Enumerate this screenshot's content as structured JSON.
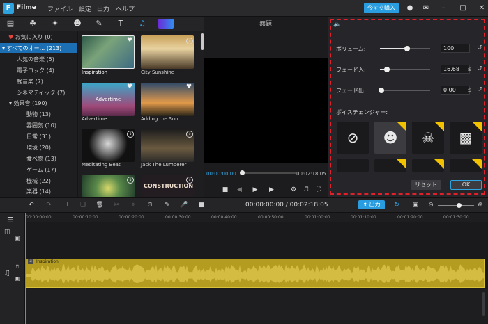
{
  "titlebar": {
    "app_name": "Filme",
    "menus": [
      "ファイル",
      "設定",
      "出力",
      "ヘルプ"
    ],
    "buy_label": "今すぐ購入",
    "window_controls": [
      "minimize-icon",
      "restore-icon",
      "close-icon"
    ]
  },
  "toolbar": {
    "icons": [
      "calendar-icon",
      "layers-icon",
      "sparkle-icon",
      "emoji-icon",
      "edit-icon",
      "text-icon",
      "music-icon",
      "effects-tip-icon"
    ],
    "active": "music-icon",
    "accent_color": "#2fa3e0"
  },
  "tree": {
    "favorites": "お気に入り (0)",
    "all_music": "すべてのオー... (213)",
    "items": [
      "人気の音楽 (5)",
      "電子ロック (4)",
      "軽音楽 (7)",
      "シネマティック (7)"
    ],
    "sfx": "効果音 (190)",
    "sfx_items": [
      "動物 (13)",
      "雰囲気 (10)",
      "日常 (31)",
      "環境 (20)",
      "食べ物 (13)",
      "ゲーム (17)",
      "機械 (22)",
      "楽器 (14)"
    ]
  },
  "media": [
    {
      "name": "Inspiration",
      "badge": "heart"
    },
    {
      "name": "City Sunshine",
      "badge": "download"
    },
    {
      "name": "Advertime",
      "badge": "heart"
    },
    {
      "name": "Adding the Sun",
      "badge": "heart"
    },
    {
      "name": "Meditating Beat",
      "badge": "download"
    },
    {
      "name": "Jack The Lumberer",
      "badge": "download"
    },
    {
      "name": "",
      "badge": "download"
    },
    {
      "name": "",
      "badge": "download"
    }
  ],
  "thumb_overlays": {
    "advertime": "Advertime",
    "constructor": "CONSTRUCTION"
  },
  "preview": {
    "title": "無題",
    "current_time": "00:00:00:00",
    "total_time": "00:02:18:05",
    "progress": 0.0
  },
  "audio_panel": {
    "volume_label": "ボリューム:",
    "volume_value": "100",
    "volume_fraction": 0.5,
    "fadein_label": "フェード入:",
    "fadein_value": "16.68",
    "fadein_unit": "s",
    "fadein_fraction": 0.1,
    "fadeout_label": "フェード出:",
    "fadeout_value": "0.00",
    "fadeout_unit": "s",
    "fadeout_fraction": 0.0,
    "voice_changer_label": "ボイスチェンジャー:",
    "voices": [
      "none-icon",
      "beard-man-icon",
      "monster-icon",
      "robot-icon"
    ],
    "selected_voice": "beard-man-icon",
    "vip_badge": "VIP",
    "reset_label": "リセット",
    "ok_label": "OK",
    "highlight_color": "#e0202a"
  },
  "timeline": {
    "time_display": "00:00:00:00 / 00:02:18:05",
    "export_label": "出力",
    "ticks": [
      "00:00:00:00",
      "00:00:10:00",
      "00:00:20:00",
      "00:00:30:00",
      "00:00:40:00",
      "00:00:50:00",
      "00:01:00:00",
      "00:01:10:00",
      "00:01:20:00",
      "00:01:30:00"
    ],
    "audio_clip_name": "Inspiration",
    "audio_clip_color": "#b39c20"
  }
}
